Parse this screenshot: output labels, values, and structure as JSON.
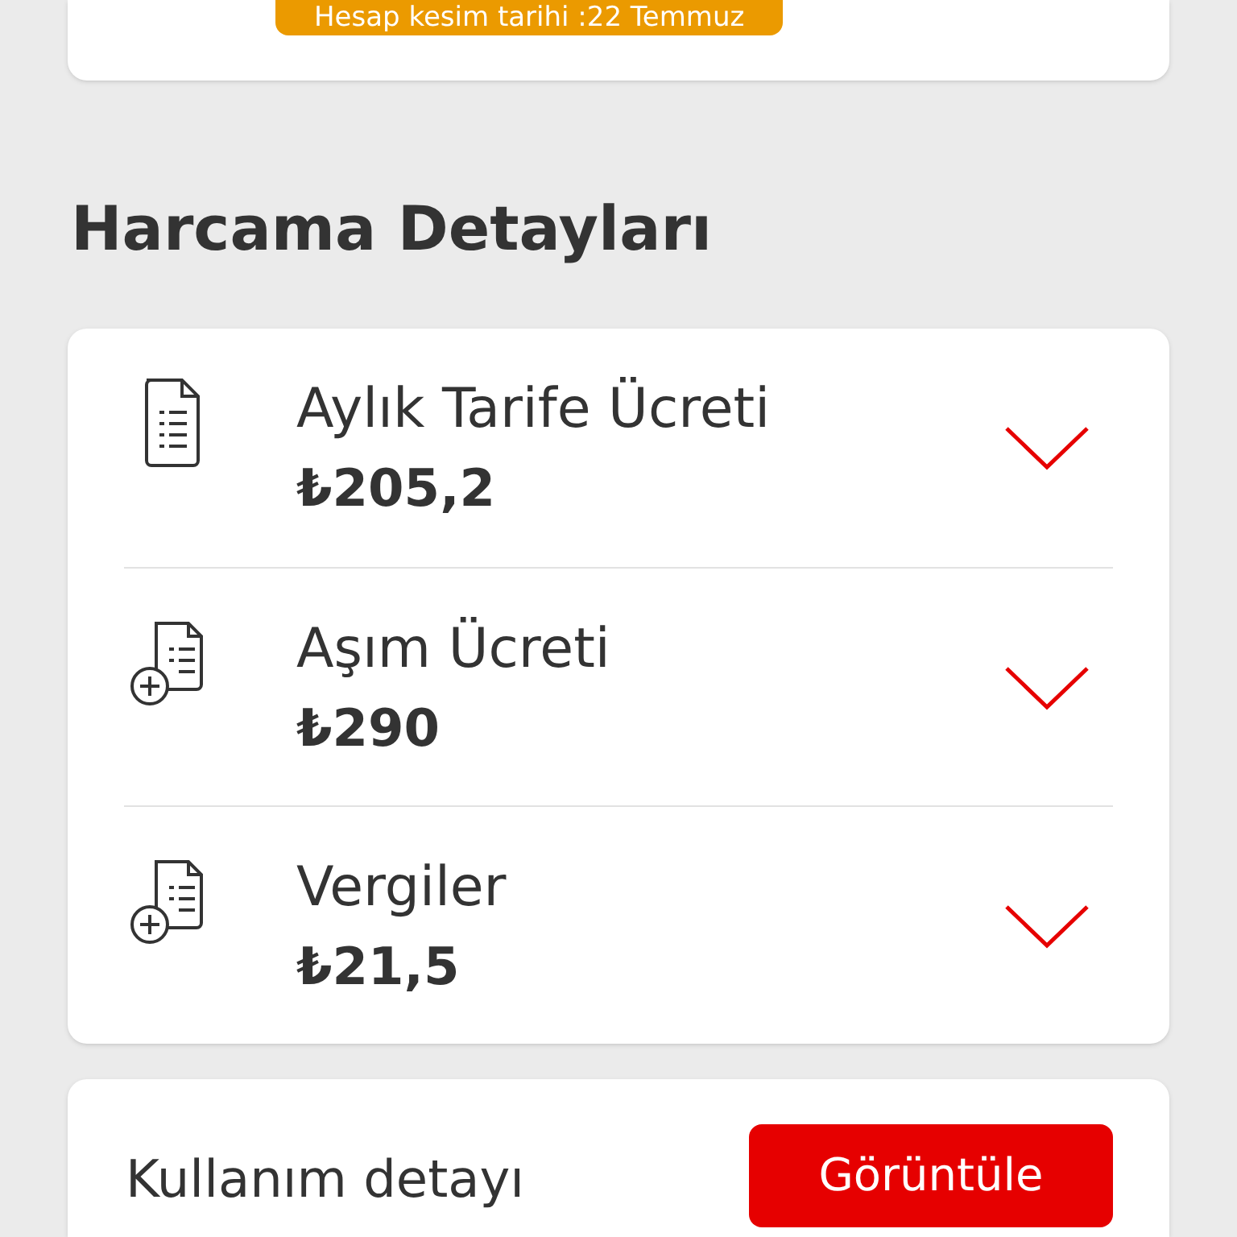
{
  "billing_badge": "Hesap kesim tarihi :22 Temmuz",
  "section_title": "Harcama Detayları",
  "items": [
    {
      "kind": "document",
      "title": "Aylık Tarife Ücreti",
      "amount": "₺205,2",
      "expanded": false
    },
    {
      "kind": "document-plus",
      "title": "Aşım Ücreti",
      "amount": "₺290",
      "expanded": false
    },
    {
      "kind": "document-plus",
      "title": "Vergiler",
      "amount": "₺21,5",
      "expanded": false
    }
  ],
  "usage": {
    "label": "Kullanım detayı",
    "button": "Görüntüle"
  }
}
